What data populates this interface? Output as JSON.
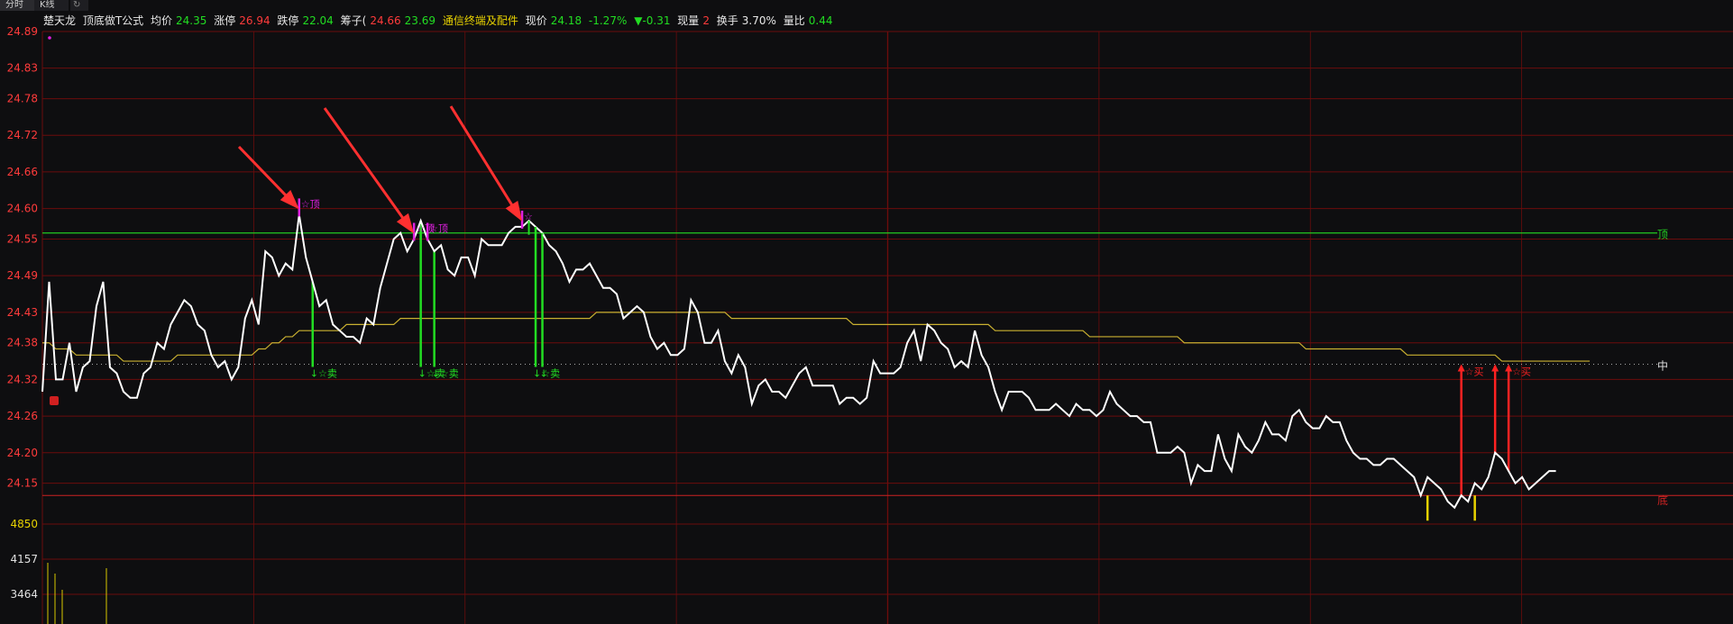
{
  "tabs": [
    {
      "label": "分时"
    },
    {
      "label": "K线"
    }
  ],
  "header": {
    "stock": "楚天龙",
    "formula": "顶底做T公式",
    "avg_label": "均价",
    "avg_value": "24.35",
    "limit_up_label": "涨停",
    "limit_up_value": "26.94",
    "limit_down_label": "跌停",
    "limit_down_value": "22.04",
    "chip_label": "筹子(",
    "chip_high": "24.66",
    "chip_low": "23.69",
    "sector": "通信终端及配件",
    "price_label": "现价",
    "price_value": "24.18",
    "pct_change": "-1.27%",
    "change": "▼-0.31",
    "vol_label": "现量",
    "vol_value": "2",
    "turnover_label": "换手",
    "turnover_value": "3.70%",
    "vol_ratio_label": "量比",
    "vol_ratio_value": "0.44"
  },
  "chart_data": {
    "type": "line",
    "y_ticks": [
      "24.89",
      "24.83",
      "24.78",
      "24.72",
      "24.66",
      "24.60",
      "24.55",
      "24.49",
      "24.43",
      "24.38",
      "24.32",
      "24.26",
      "24.20",
      "24.15"
    ],
    "ylim": [
      24.12,
      24.89
    ],
    "volume_ticks": [
      "4850",
      "4157",
      "3464"
    ],
    "x_points": 240,
    "price": [
      24.3,
      24.48,
      24.32,
      24.32,
      24.38,
      24.3,
      24.34,
      24.35,
      24.44,
      24.48,
      24.34,
      24.33,
      24.3,
      24.29,
      24.29,
      24.33,
      24.34,
      24.38,
      24.37,
      24.41,
      24.43,
      24.45,
      24.44,
      24.41,
      24.4,
      24.36,
      24.34,
      24.35,
      24.32,
      24.34,
      24.42,
      24.45,
      24.41,
      24.53,
      24.52,
      24.49,
      24.51,
      24.5,
      24.59,
      24.52,
      24.48,
      24.44,
      24.45,
      24.41,
      24.4,
      24.39,
      24.39,
      24.38,
      24.42,
      24.41,
      24.47,
      24.51,
      24.55,
      24.56,
      24.53,
      24.55,
      24.58,
      24.55,
      24.53,
      24.54,
      24.5,
      24.49,
      24.52,
      24.52,
      24.49,
      24.55,
      24.54,
      24.54,
      24.54,
      24.56,
      24.57,
      24.57,
      24.58,
      24.57,
      24.56,
      24.54,
      24.53,
      24.51,
      24.48,
      24.5,
      24.5,
      24.51,
      24.49,
      24.47,
      24.47,
      24.46,
      24.42,
      24.43,
      24.44,
      24.43,
      24.39,
      24.37,
      24.38,
      24.36,
      24.36,
      24.37,
      24.45,
      24.43,
      24.38,
      24.38,
      24.4,
      24.35,
      24.33,
      24.36,
      24.34,
      24.28,
      24.31,
      24.32,
      24.3,
      24.3,
      24.29,
      24.31,
      24.33,
      24.34,
      24.31,
      24.31,
      24.31,
      24.31,
      24.28,
      24.29,
      24.29,
      24.28,
      24.29,
      24.35,
      24.33,
      24.33,
      24.33,
      24.34,
      24.38,
      24.4,
      24.35,
      24.41,
      24.4,
      24.38,
      24.37,
      24.34,
      24.35,
      24.34,
      24.4,
      24.36,
      24.34,
      24.3,
      24.27,
      24.3,
      24.3,
      24.3,
      24.29,
      24.27,
      24.27,
      24.27,
      24.28,
      24.27,
      24.26,
      24.28,
      24.27,
      24.27,
      24.26,
      24.27,
      24.3,
      24.28,
      24.27,
      24.26,
      24.26,
      24.25,
      24.25,
      24.2,
      24.2,
      24.2,
      24.21,
      24.2,
      24.15,
      24.18,
      24.17,
      24.17,
      24.23,
      24.19,
      24.17,
      24.23,
      24.21,
      24.2,
      24.22,
      24.25,
      24.23,
      24.23,
      24.22,
      24.26,
      24.27,
      24.25,
      24.24,
      24.24,
      24.26,
      24.25,
      24.25,
      24.22,
      24.2,
      24.19,
      24.19,
      24.18,
      24.18,
      24.19,
      24.19,
      24.18,
      24.17,
      24.16,
      24.13,
      24.16,
      24.15,
      24.14,
      24.12,
      24.11,
      24.13,
      24.12,
      24.15,
      24.14,
      24.16,
      24.2,
      24.19,
      24.17,
      24.15,
      24.16,
      24.14,
      24.15,
      24.16,
      24.17,
      24.17
    ],
    "avg": [
      24.38,
      24.38,
      24.37,
      24.37,
      24.37,
      24.36,
      24.36,
      24.36,
      24.36,
      24.36,
      24.36,
      24.36,
      24.35,
      24.35,
      24.35,
      24.35,
      24.35,
      24.35,
      24.35,
      24.35,
      24.36,
      24.36,
      24.36,
      24.36,
      24.36,
      24.36,
      24.36,
      24.36,
      24.36,
      24.36,
      24.36,
      24.36,
      24.37,
      24.37,
      24.38,
      24.38,
      24.39,
      24.39,
      24.4,
      24.4,
      24.4,
      24.4,
      24.4,
      24.4,
      24.4,
      24.41,
      24.41,
      24.41,
      24.41,
      24.41,
      24.41,
      24.41,
      24.41,
      24.42,
      24.42,
      24.42,
      24.42,
      24.42,
      24.42,
      24.42,
      24.42,
      24.42,
      24.42,
      24.42,
      24.42,
      24.42,
      24.42,
      24.42,
      24.42,
      24.42,
      24.42,
      24.42,
      24.42,
      24.42,
      24.42,
      24.42,
      24.42,
      24.42,
      24.42,
      24.42,
      24.42,
      24.42,
      24.43,
      24.43,
      24.43,
      24.43,
      24.43,
      24.43,
      24.43,
      24.43,
      24.43,
      24.43,
      24.43,
      24.43,
      24.43,
      24.43,
      24.43,
      24.43,
      24.43,
      24.43,
      24.43,
      24.43,
      24.42,
      24.42,
      24.42,
      24.42,
      24.42,
      24.42,
      24.42,
      24.42,
      24.42,
      24.42,
      24.42,
      24.42,
      24.42,
      24.42,
      24.42,
      24.42,
      24.42,
      24.42,
      24.41,
      24.41,
      24.41,
      24.41,
      24.41,
      24.41,
      24.41,
      24.41,
      24.41,
      24.41,
      24.41,
      24.41,
      24.41,
      24.41,
      24.41,
      24.41,
      24.41,
      24.41,
      24.41,
      24.41,
      24.41,
      24.4,
      24.4,
      24.4,
      24.4,
      24.4,
      24.4,
      24.4,
      24.4,
      24.4,
      24.4,
      24.4,
      24.4,
      24.4,
      24.4,
      24.39,
      24.39,
      24.39,
      24.39,
      24.39,
      24.39,
      24.39,
      24.39,
      24.39,
      24.39,
      24.39,
      24.39,
      24.39,
      24.39,
      24.38,
      24.38,
      24.38,
      24.38,
      24.38,
      24.38,
      24.38,
      24.38,
      24.38,
      24.38,
      24.38,
      24.38,
      24.38,
      24.38,
      24.38,
      24.38,
      24.38,
      24.38,
      24.37,
      24.37,
      24.37,
      24.37,
      24.37,
      24.37,
      24.37,
      24.37,
      24.37,
      24.37,
      24.37,
      24.37,
      24.37,
      24.37,
      24.37,
      24.36,
      24.36,
      24.36,
      24.36,
      24.36,
      24.36,
      24.36,
      24.36,
      24.36,
      24.36,
      24.36,
      24.36,
      24.36,
      24.36,
      24.35,
      24.35,
      24.35,
      24.35,
      24.35,
      24.35,
      24.35,
      24.35,
      24.35,
      24.35,
      24.35,
      24.35,
      24.35,
      24.35
    ],
    "top_level": 24.56,
    "mid_level": 24.345,
    "bottom_level": 24.13,
    "level_labels": {
      "top": "顶",
      "mid": "中",
      "bottom": "底"
    },
    "top_markers": [
      {
        "i": 38,
        "label": "☆顶"
      },
      {
        "i": 55,
        "label": "☆顶"
      },
      {
        "i": 57,
        "label": "☆顶"
      },
      {
        "i": 71,
        "label": "☆"
      }
    ],
    "sell_markers": [
      {
        "i": 40,
        "label": "☆卖"
      },
      {
        "i": 56,
        "label": "☆卖"
      },
      {
        "i": 58,
        "label": "☆卖"
      },
      {
        "i": 73,
        "label": "☆卖"
      },
      {
        "i": 74,
        "label": ""
      }
    ],
    "buy_markers": [
      {
        "i": 210,
        "label": "☆买"
      },
      {
        "i": 215,
        "label": ""
      },
      {
        "i": 217,
        "label": "☆买"
      }
    ],
    "colors": {
      "price": "#ffffff",
      "avg": "#c9b030",
      "grid": "#6b0c0c",
      "tick": "#ff3b3b",
      "top": "#22cc22",
      "bottom": "#cc2222",
      "mid": "#aaaaaa",
      "sell": "#22dd22",
      "buy": "#ff2222",
      "top_marker": "#e020e0",
      "arrow": "#ff3030",
      "volume": "#d8c800"
    }
  }
}
